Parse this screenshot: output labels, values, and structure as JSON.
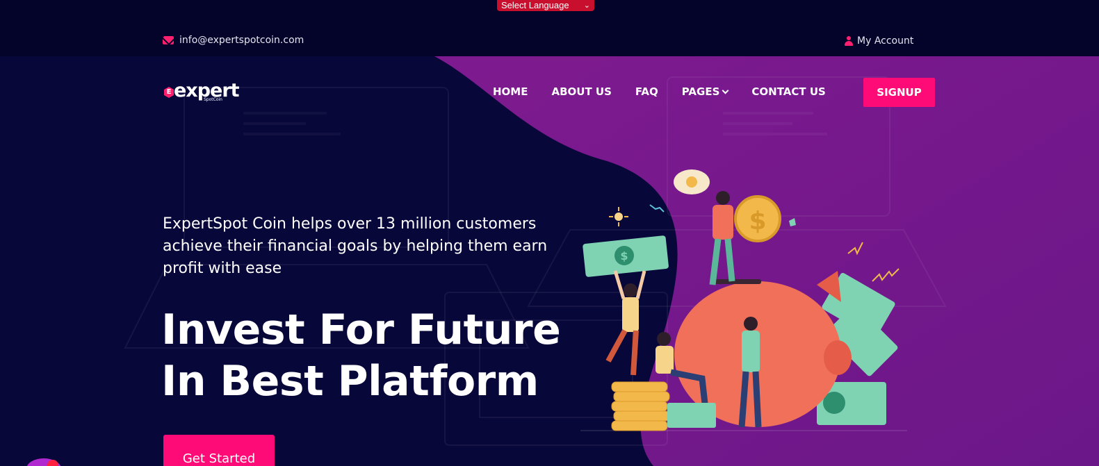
{
  "language_selector": {
    "label": "Select Language"
  },
  "topbar": {
    "email": "info@expertspotcoin.com",
    "account_label": "My Account"
  },
  "logo": {
    "name": "expert",
    "sub": "SpotCoin",
    "badge": "E"
  },
  "nav": {
    "items": [
      {
        "label": "HOME"
      },
      {
        "label": "ABOUT US"
      },
      {
        "label": "FAQ"
      },
      {
        "label": "PAGES"
      },
      {
        "label": "CONTACT US"
      }
    ],
    "signup_label": "SIGNUP"
  },
  "hero": {
    "intro": "ExpertSpot Coin helps over 13 million customers achieve their financial goals by helping them earn profit with ease",
    "headline_line1": "Invest For Future",
    "headline_line2": "In Best Platform",
    "cta_label": "Get Started",
    "coin_symbol": "$"
  },
  "colors": {
    "accent": "#ff0b77",
    "navy": "#07062e",
    "purple": "#7a1a8c",
    "lang_red": "#c8102e"
  }
}
